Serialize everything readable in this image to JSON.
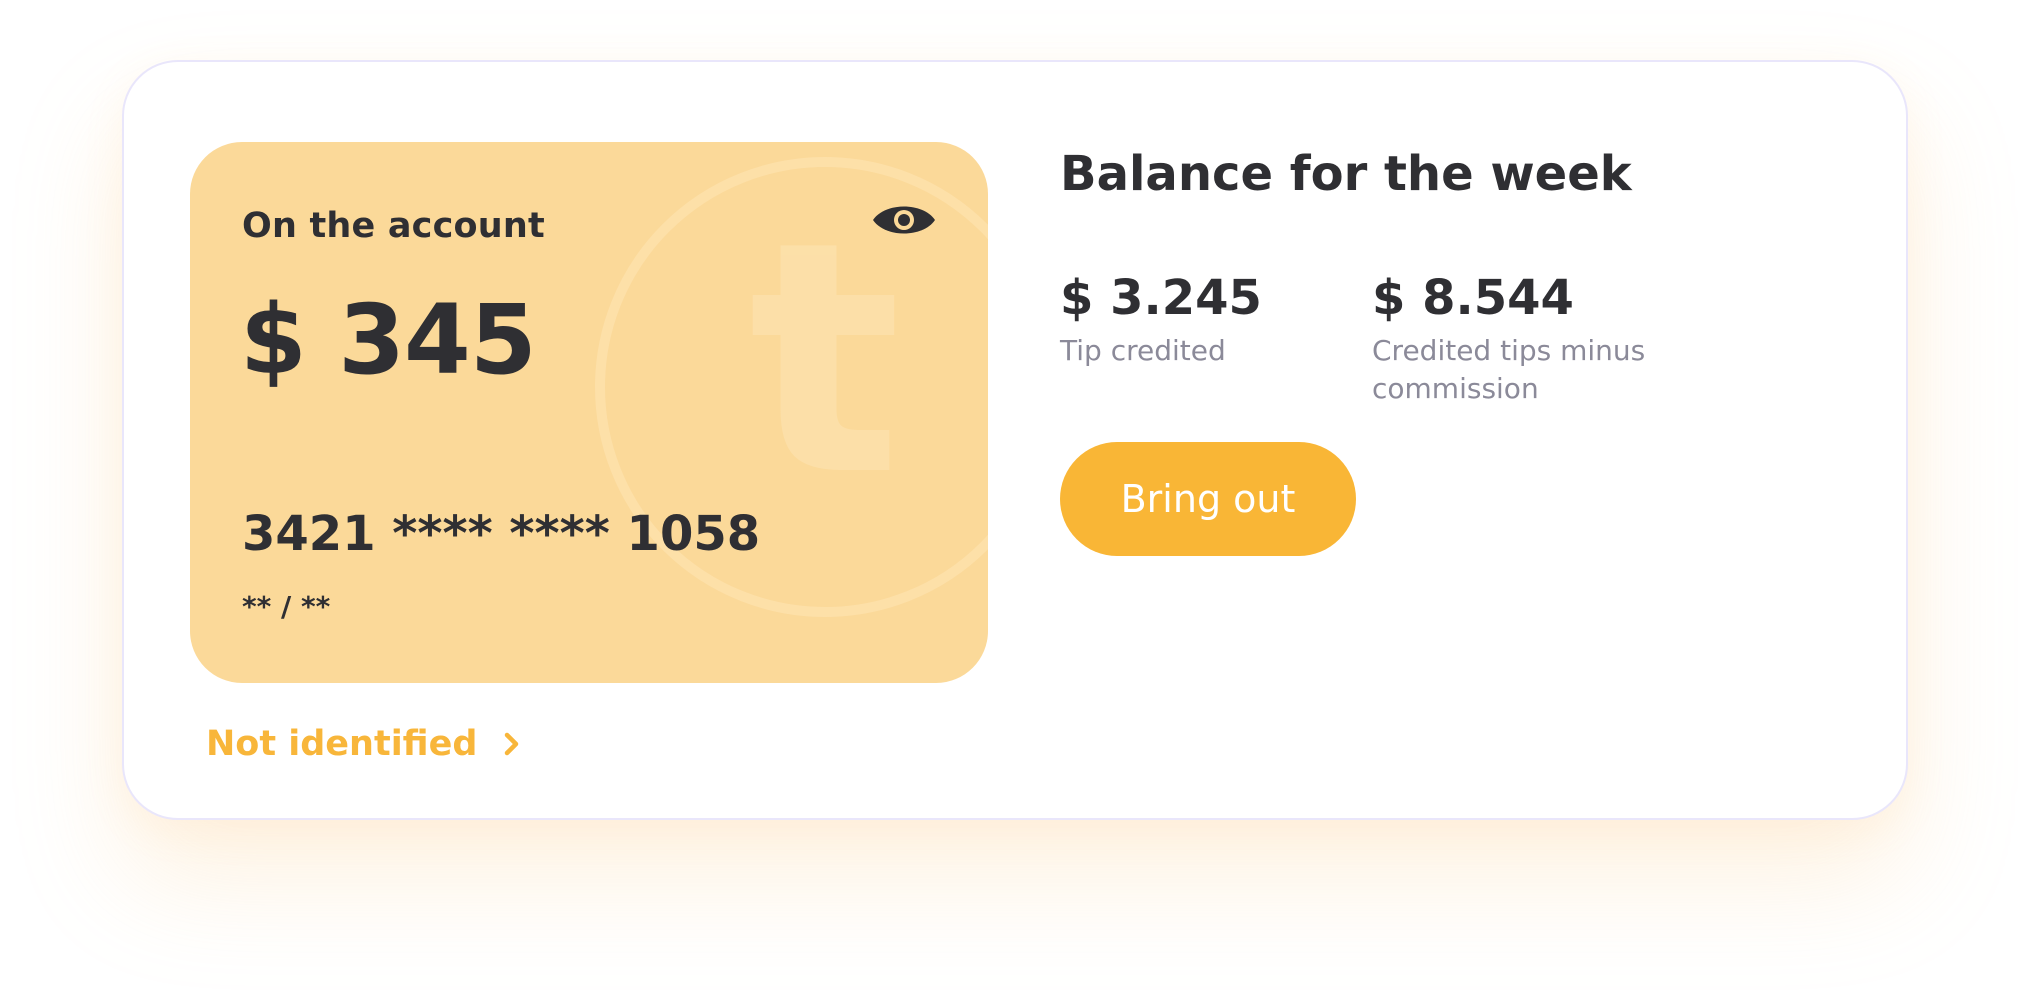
{
  "card": {
    "label": "On the account",
    "amount": "$ 345",
    "number": "3421 **** **** 1058",
    "expiry": "** / **",
    "watermark_letter": "t",
    "visibility_icon": "eye-icon"
  },
  "status": {
    "label": "Not identified",
    "icon": "chevron-right-icon"
  },
  "week": {
    "title": "Balance for the week",
    "stats": [
      {
        "value": "$ 3.245",
        "label": "Tip credited"
      },
      {
        "value": "$ 8.544",
        "label": "Credited tips minus commission"
      }
    ],
    "bring_out_label": "Bring out"
  },
  "colors": {
    "accent": "#f9b636",
    "card_background": "#fbd999",
    "text_primary": "#2f2f33",
    "text_secondary": "#8b8a99",
    "panel_border": "#e9e6fb"
  }
}
